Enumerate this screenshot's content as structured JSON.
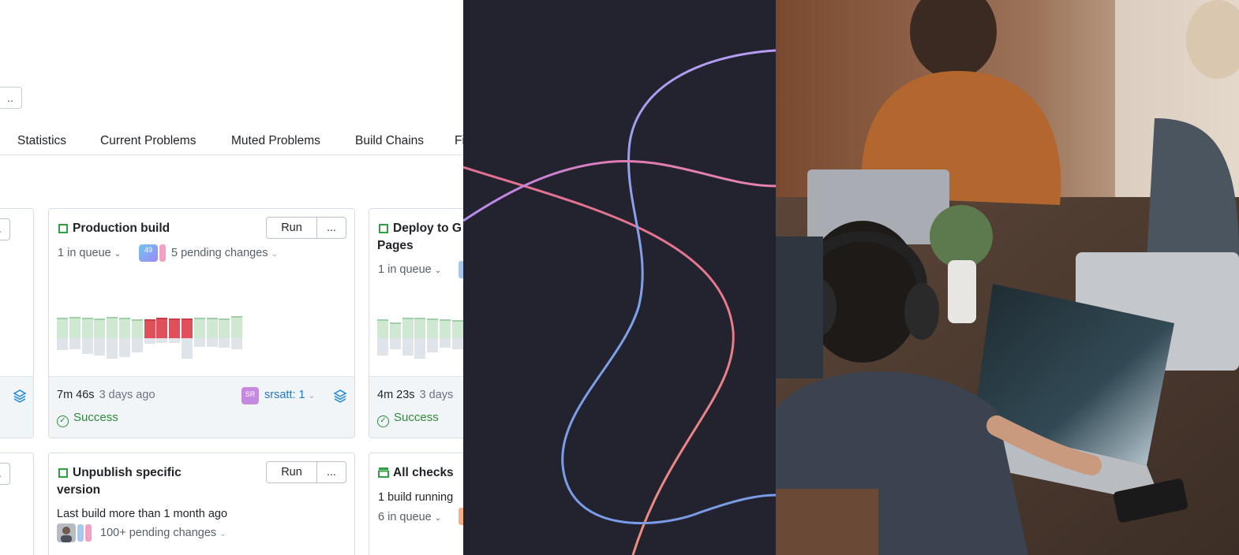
{
  "top_button": {
    "label": ".."
  },
  "tabs": [
    "Statistics",
    "Current Problems",
    "Muted Problems",
    "Build Chains",
    "Fi"
  ],
  "cards": {
    "production": {
      "title": "Production build",
      "run_label": "Run",
      "more_label": "...",
      "queue": "1 in queue",
      "badge": "49",
      "pending": "5 pending changes",
      "duration": "7m 46s",
      "ago": "3 days ago",
      "user_initials": "SR",
      "user": "srsatt: 1",
      "status": "Success"
    },
    "deploy": {
      "title_line1": "Deploy to G",
      "title_line2": "Pages",
      "queue": "1 in queue",
      "duration": "4m 23s",
      "ago": "3 days",
      "status": "Success"
    },
    "unpublish": {
      "title_line1": "Unpublish specific",
      "title_line2": "version",
      "run_label": "Run",
      "more_label": "...",
      "last_build": "Last build more than 1 month ago",
      "pending": "100+ pending changes"
    },
    "all_checks": {
      "title": "All checks",
      "running": "1 build running",
      "queue": "6 in queue"
    },
    "left_more_label": "..."
  },
  "colors": {
    "success": "#2f8a3a",
    "failed_bar": "#e0505a",
    "passed_bar": "#cfe8d2",
    "link": "#2577c9",
    "dark_panel": "#22232f"
  }
}
